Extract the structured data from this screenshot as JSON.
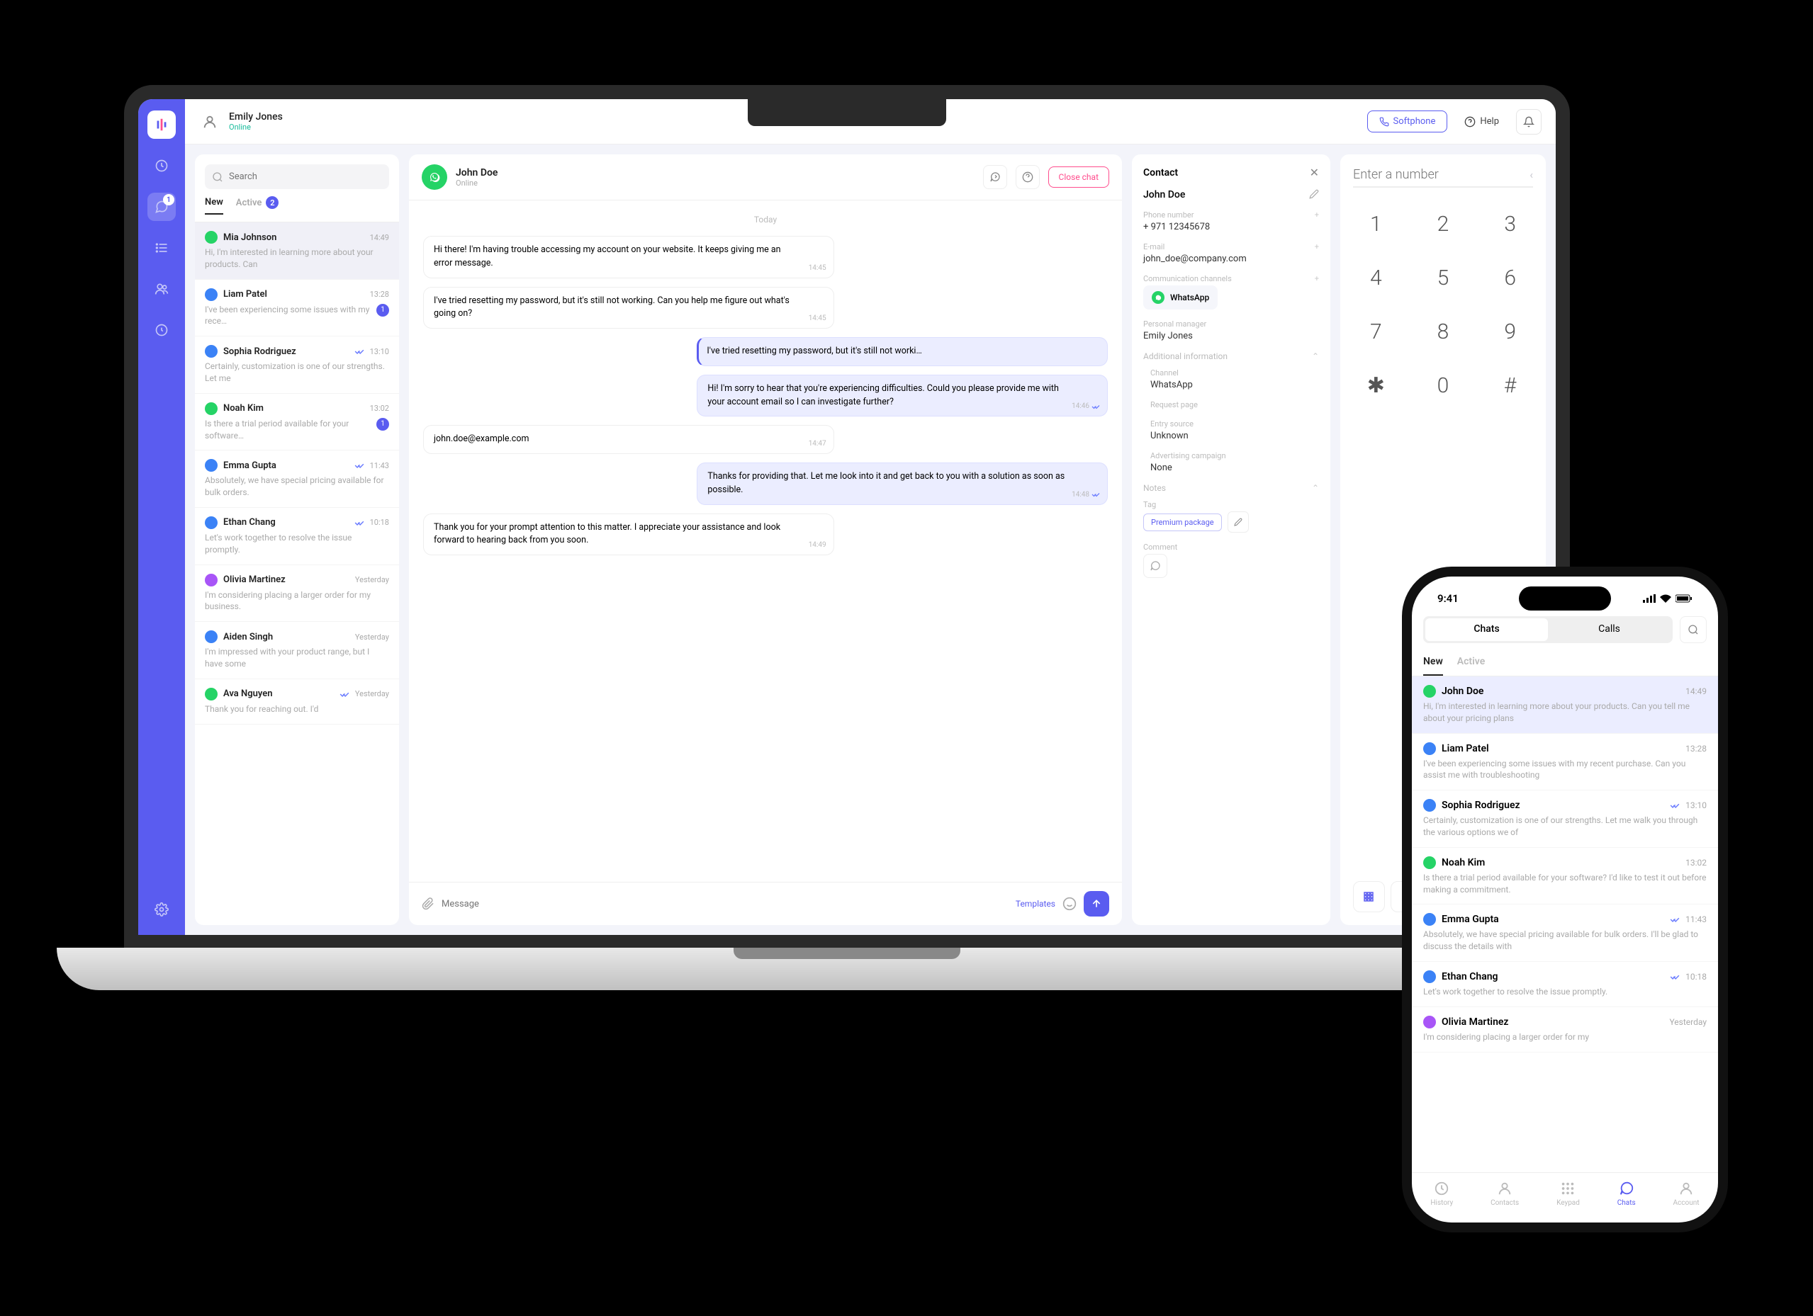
{
  "topbar": {
    "user_name": "Emily Jones",
    "user_status": "Online",
    "softphone_label": "Softphone",
    "help_label": "Help"
  },
  "rail": {
    "chats_badge": "1"
  },
  "chatlist": {
    "search_placeholder": "Search",
    "tab_new": "New",
    "tab_active": "Active",
    "active_badge": "2",
    "items": [
      {
        "name": "Mia Johnson",
        "time": "14:49",
        "snippet": "Hi, I'm interested in learning more about your products. Can",
        "color": "av-green",
        "read": false,
        "unread": "",
        "sel": true
      },
      {
        "name": "Liam Patel",
        "time": "13:28",
        "snippet": "I've been experiencing some issues with my rece…",
        "color": "av-blue",
        "read": false,
        "unread": "1",
        "sel": false
      },
      {
        "name": "Sophia Rodriguez",
        "time": "13:10",
        "snippet": "Certainly, customization is one of our strengths. Let me",
        "color": "av-blue",
        "read": true,
        "unread": "",
        "sel": false
      },
      {
        "name": "Noah Kim",
        "time": "13:02",
        "snippet": "Is there a trial period available for your software…",
        "color": "av-green",
        "read": false,
        "unread": "1",
        "sel": false
      },
      {
        "name": "Emma Gupta",
        "time": "11:43",
        "snippet": "Absolutely, we have special pricing available for bulk orders.",
        "color": "av-blue",
        "read": true,
        "unread": "",
        "sel": false
      },
      {
        "name": "Ethan Chang",
        "time": "10:18",
        "snippet": "Let's work together to resolve the issue promptly.",
        "color": "av-blue",
        "read": true,
        "unread": "",
        "sel": false
      },
      {
        "name": "Olivia Martinez",
        "time": "Yesterday",
        "snippet": "I'm considering placing a larger order for my business.",
        "color": "av-purple",
        "read": false,
        "unread": "",
        "sel": false
      },
      {
        "name": "Aiden Singh",
        "time": "Yesterday",
        "snippet": "I'm impressed with your product range, but I have some",
        "color": "av-blue",
        "read": false,
        "unread": "",
        "sel": false
      },
      {
        "name": "Ava Nguyen",
        "time": "Yesterday",
        "snippet": "Thank you for reaching out. I'd",
        "color": "av-green",
        "read": true,
        "unread": "",
        "sel": false
      }
    ]
  },
  "chatview": {
    "contact_name": "John Doe",
    "contact_status": "Online",
    "close_label": "Close chat",
    "date_divider": "Today",
    "messages": [
      {
        "dir": "in",
        "text": "Hi there! I'm having trouble accessing my account on your website. It keeps giving me an error message.",
        "time": "14:45",
        "quote": false
      },
      {
        "dir": "in",
        "text": "I've tried resetting my password, but it's still not working. Can you help me figure out what's going on?",
        "time": "14:45",
        "quote": false
      },
      {
        "dir": "out",
        "text": "I've tried resetting my password, but it's still not worki…",
        "time": "",
        "quote": true
      },
      {
        "dir": "out",
        "text": "Hi! I'm sorry to hear that you're experiencing difficulties. Could you please provide me with your account email so I can investigate further?",
        "time": "14:46",
        "quote": false
      },
      {
        "dir": "in",
        "text": "john.doe@example.com",
        "time": "14:47",
        "quote": false
      },
      {
        "dir": "out",
        "text": "Thanks for providing that. Let me look into it and get back to you with a solution as soon as possible.",
        "time": "14:48",
        "quote": false
      },
      {
        "dir": "in",
        "text": "Thank you for your prompt attention to this matter. I appreciate your assistance and look forward to hearing back from you soon.",
        "time": "14:49",
        "quote": false
      }
    ],
    "input_placeholder": "Message",
    "templates_label": "Templates"
  },
  "contact": {
    "panel_title": "Contact",
    "name": "John Doe",
    "phone_label": "Phone number",
    "phone_value": "+ 971 12345678",
    "email_label": "E-mail",
    "email_value": "john_doe@company.com",
    "channels_label": "Communication channels",
    "channel_value": "WhatsApp",
    "manager_label": "Personal manager",
    "manager_value": "Emily Jones",
    "additional_label": "Additional information",
    "channel_field_label": "Channel",
    "channel_field_value": "WhatsApp",
    "request_page_label": "Request page",
    "entry_source_label": "Entry source",
    "entry_source_value": "Unknown",
    "campaign_label": "Advertising campaign",
    "campaign_value": "None",
    "notes_label": "Notes",
    "tag_label": "Tag",
    "tag_value": "Premium package",
    "comment_label": "Comment"
  },
  "dialer": {
    "input_placeholder": "Enter a number",
    "keys": [
      "1",
      "2",
      "3",
      "4",
      "5",
      "6",
      "7",
      "8",
      "9",
      "✱",
      "0",
      "#"
    ]
  },
  "phone": {
    "time": "9:41",
    "seg_chats": "Chats",
    "seg_calls": "Calls",
    "tab_new": "New",
    "tab_active": "Active",
    "nav": [
      {
        "label": "History",
        "active": false
      },
      {
        "label": "Contacts",
        "active": false
      },
      {
        "label": "Keypad",
        "active": false
      },
      {
        "label": "Chats",
        "active": true
      },
      {
        "label": "Account",
        "active": false
      }
    ],
    "items": [
      {
        "name": "John Doe",
        "time": "14:49",
        "snippet": "Hi, I'm interested in learning more about your products. Can you tell me about your pricing plans",
        "color": "av-green",
        "read": false,
        "sel": true
      },
      {
        "name": "Liam Patel",
        "time": "13:28",
        "snippet": "I've been experiencing some issues with my recent purchase. Can you assist me with troubleshooting",
        "color": "av-blue",
        "read": false,
        "sel": false
      },
      {
        "name": "Sophia Rodriguez",
        "time": "13:10",
        "snippet": "Certainly, customization is one of our strengths. Let me walk you through the various options we of",
        "color": "av-blue",
        "read": true,
        "sel": false
      },
      {
        "name": "Noah Kim",
        "time": "13:02",
        "snippet": "Is there a trial period available for your software? I'd like to test it out before making a commitment.",
        "color": "av-green",
        "read": false,
        "sel": false
      },
      {
        "name": "Emma Gupta",
        "time": "11:43",
        "snippet": "Absolutely, we have special pricing available for bulk orders. I'll be glad to discuss the details with",
        "color": "av-blue",
        "read": true,
        "sel": false
      },
      {
        "name": "Ethan Chang",
        "time": "10:18",
        "snippet": "Let's work together to resolve the issue promptly.",
        "color": "av-blue",
        "read": true,
        "sel": false
      },
      {
        "name": "Olivia Martinez",
        "time": "Yesterday",
        "snippet": "I'm considering placing a larger order for my",
        "color": "av-purple",
        "read": false,
        "sel": false
      }
    ]
  }
}
